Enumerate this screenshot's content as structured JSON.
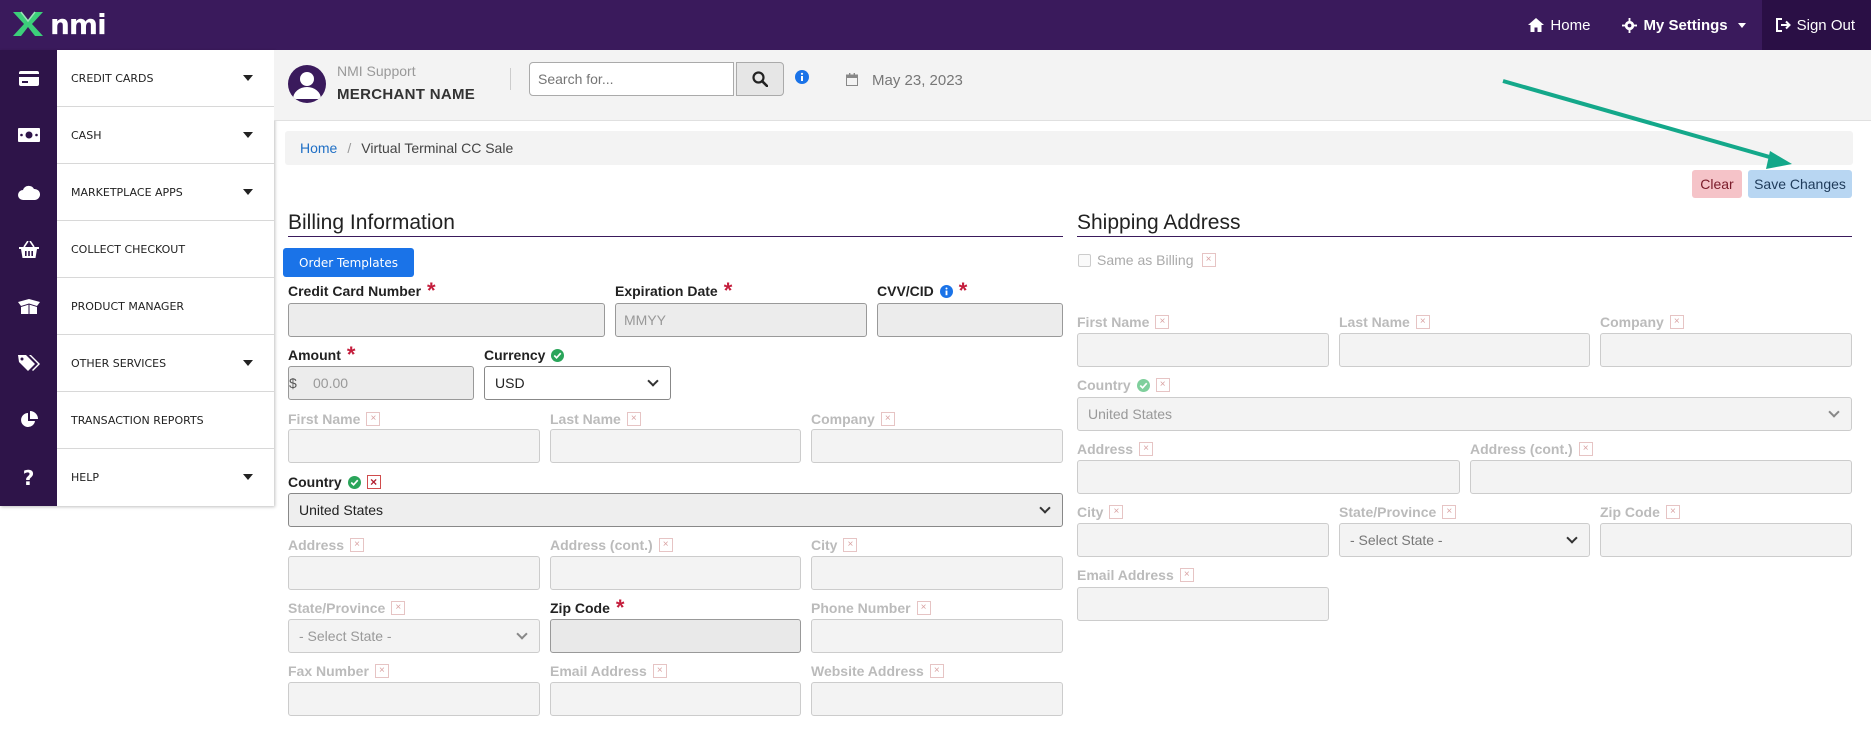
{
  "brand": {
    "logo_text": "nmi"
  },
  "topnav": {
    "home": "Home",
    "settings": "My Settings",
    "signout": "Sign Out"
  },
  "sidebar": {
    "items": [
      {
        "label": "CREDIT CARDS"
      },
      {
        "label": "CASH"
      },
      {
        "label": "MARKETPLACE APPS"
      },
      {
        "label": "COLLECT CHECKOUT"
      },
      {
        "label": "PRODUCT MANAGER"
      },
      {
        "label": "OTHER SERVICES"
      },
      {
        "label": "TRANSACTION REPORTS"
      },
      {
        "label": "HELP"
      }
    ]
  },
  "header": {
    "support_name": "NMI Support",
    "merchant_name": "MERCHANT NAME",
    "search_placeholder": "Search for...",
    "date": "May 23, 2023"
  },
  "breadcrumb": {
    "home": "Home",
    "current": "Virtual Terminal CC Sale"
  },
  "actions": {
    "clear": "Clear",
    "save": "Save Changes"
  },
  "billing": {
    "title": "Billing Information",
    "order_templates": "Order Templates",
    "credit_card_number": "Credit Card Number",
    "expiration_date": "Expiration Date",
    "expiration_placeholder": "MMYY",
    "cvv": "CVV/CID",
    "amount": "Amount",
    "amount_prefix": "$",
    "amount_placeholder": "00.00",
    "currency": "Currency",
    "currency_value": "USD",
    "first_name": "First Name",
    "last_name": "Last Name",
    "company": "Company",
    "country": "Country",
    "country_value": "United States",
    "address": "Address",
    "address_cont": "Address (cont.)",
    "city": "City",
    "state": "State/Province",
    "state_value": "- Select State -",
    "zip": "Zip Code",
    "phone": "Phone Number",
    "fax": "Fax Number",
    "email": "Email Address",
    "website": "Website Address"
  },
  "shipping": {
    "title": "Shipping Address",
    "same_as_billing": "Same as Billing",
    "first_name": "First Name",
    "last_name": "Last Name",
    "company": "Company",
    "country": "Country",
    "country_value": "United States",
    "address": "Address",
    "address_cont": "Address (cont.)",
    "city": "City",
    "state": "State/Province",
    "state_value": "- Select State -",
    "zip": "Zip Code",
    "email": "Email Address"
  },
  "colors": {
    "brand_purple": "#3a1a5c",
    "sidebar_icon_bg": "#2e1449",
    "primary_blue": "#1a73e8",
    "required_red": "#c41d3c",
    "annotation_arrow": "#14a88a"
  },
  "x_mark": "×"
}
